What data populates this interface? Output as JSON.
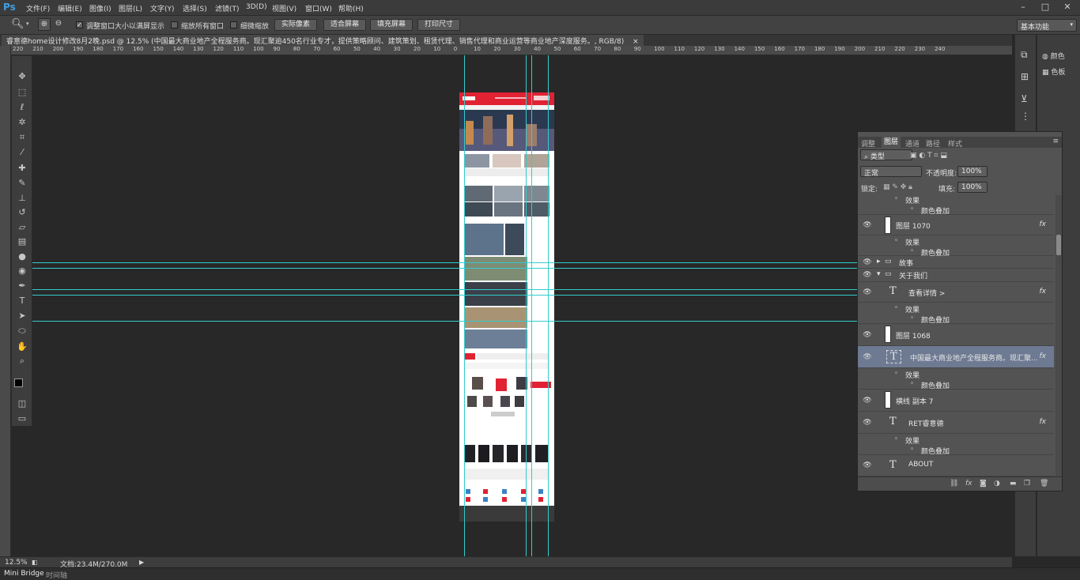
{
  "app": {
    "logo": "Ps",
    "menu": [
      "文件(F)",
      "编辑(E)",
      "图像(I)",
      "图层(L)",
      "文字(Y)",
      "选择(S)",
      "滤镜(T)",
      "3D(D)",
      "视图(V)",
      "窗口(W)",
      "帮助(H)"
    ],
    "window_controls": [
      "–",
      "□",
      "✕"
    ]
  },
  "options": {
    "check1": "调整窗口大小以满屏显示",
    "check2": "缩放所有窗口",
    "check3": "细微缩放",
    "btn_actual": "实际像素",
    "btn_fit": "适合屏幕",
    "btn_fill": "填充屏幕",
    "btn_print": "打印尺寸",
    "workspace": "基本功能"
  },
  "document": {
    "tab_title": "睿意德home设计修改8月2晚.psd @ 12.5% (中国最大商业地产全程服务商。现汇聚逾450名行业专才，提供策略顾问、建筑策划、租赁代理、销售代理和商业运营等商业地产深度服务。, RGB/8)",
    "tab_close": "×"
  },
  "ruler": {
    "labels": [
      "220",
      "210",
      "200",
      "190",
      "180",
      "170",
      "160",
      "150",
      "140",
      "130",
      "120",
      "110",
      "100",
      "90",
      "80",
      "70",
      "60",
      "50",
      "40",
      "30",
      "20",
      "10",
      "0",
      "10",
      "20",
      "30",
      "40",
      "50",
      "60",
      "70",
      "80",
      "90",
      "100",
      "110",
      "120",
      "130",
      "140",
      "150",
      "160",
      "170",
      "180",
      "190",
      "200",
      "210",
      "220",
      "230",
      "240"
    ]
  },
  "status": {
    "zoom": "12.5%",
    "doc_info": "文档:23.4M/270.0M"
  },
  "bottom_tabs": [
    "Mini Bridge",
    "时间轴"
  ],
  "mini_panels": {
    "color": "颜色",
    "swatches": "色板"
  },
  "layers_panel": {
    "tabs": [
      "调整",
      "图层",
      "通道",
      "路径",
      "样式"
    ],
    "active_tab": "图层",
    "filter_kind": "类型",
    "blend_mode": "正常",
    "opacity_label": "不透明度:",
    "opacity_value": "100%",
    "lock_label": "锁定:",
    "fill_label": "填充:",
    "fill_value": "100%",
    "effects_label": "效果",
    "color_overlay": "颜色叠加",
    "layers": {
      "layer_1070": "图层 1070",
      "group_story": "故事",
      "group_about": "关于我们",
      "text_more": "查看详情 >",
      "layer_1068": "图层 1068",
      "text_intro": "中国最大商业地产全程服务商。现汇聚...",
      "line_copy": "横线 副本 7",
      "text_ret": "RET睿意德",
      "text_about": "ABOUT"
    },
    "fx": "fx"
  }
}
